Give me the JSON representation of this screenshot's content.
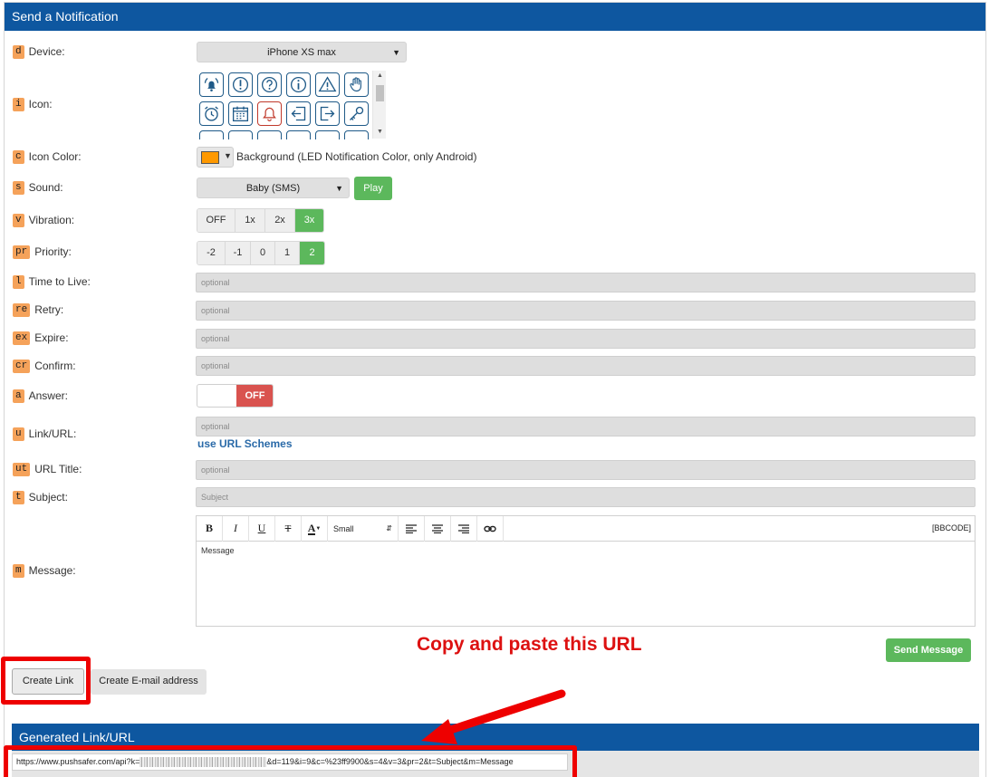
{
  "panel": {
    "title": "Send a Notification"
  },
  "fields": {
    "device": {
      "key": "d",
      "label": "Device:",
      "value": "iPhone XS max"
    },
    "icon": {
      "key": "i",
      "label": "Icon:"
    },
    "icon_color": {
      "key": "c",
      "label": "Icon Color:",
      "color": "#ff9900",
      "text": "Background (LED Notification Color, only Android)"
    },
    "sound": {
      "key": "s",
      "label": "Sound:",
      "value": "Baby (SMS)",
      "play_label": "Play"
    },
    "vibration": {
      "key": "v",
      "label": "Vibration:",
      "options": [
        "OFF",
        "1x",
        "2x",
        "3x"
      ],
      "selected": "3x"
    },
    "priority": {
      "key": "pr",
      "label": "Priority:",
      "options": [
        "-2",
        "-1",
        "0",
        "1",
        "2"
      ],
      "selected": "2"
    },
    "ttl": {
      "key": "l",
      "label": "Time to Live:",
      "placeholder": "optional"
    },
    "retry": {
      "key": "re",
      "label": "Retry:",
      "placeholder": "optional"
    },
    "expire": {
      "key": "ex",
      "label": "Expire:",
      "placeholder": "optional"
    },
    "confirm": {
      "key": "cr",
      "label": "Confirm:",
      "placeholder": "optional"
    },
    "answer": {
      "key": "a",
      "label": "Answer:",
      "state": "OFF"
    },
    "url": {
      "key": "u",
      "label": "Link/URL:",
      "placeholder": "optional",
      "help_link": "use URL Schemes"
    },
    "url_title": {
      "key": "ut",
      "label": "URL Title:",
      "placeholder": "optional"
    },
    "subject": {
      "key": "t",
      "label": "Subject:",
      "placeholder": "Subject"
    },
    "message": {
      "key": "m",
      "label": "Message:",
      "value": "Message"
    }
  },
  "editor": {
    "font_size": "Small",
    "bbcode_label": "[BBCODE]"
  },
  "icons": [
    "bell-ring-icon",
    "exclamation-icon",
    "question-icon",
    "info-icon",
    "warning-icon",
    "hand-icon",
    "alarm-clock-icon",
    "calendar-icon",
    "bell-icon",
    "arrow-left-icon",
    "exit-icon",
    "key-icon"
  ],
  "annotation": "Copy and paste this URL",
  "buttons": {
    "send": "Send Message",
    "create_link": "Create Link",
    "create_email": "Create E-mail address"
  },
  "generated": {
    "title": "Generated Link/URL",
    "url_prefix": "https://www.pushsafer.com/api?k=",
    "url_suffix": "&d=119&i=9&c=%23ff9900&s=4&v=3&pr=2&t=Subject&m=Message"
  },
  "colors": {
    "header": "#0e57a0",
    "key_badge": "#f5a25a",
    "success": "#5cb85c",
    "danger": "#d9534f",
    "highlight": "#ee0000"
  }
}
